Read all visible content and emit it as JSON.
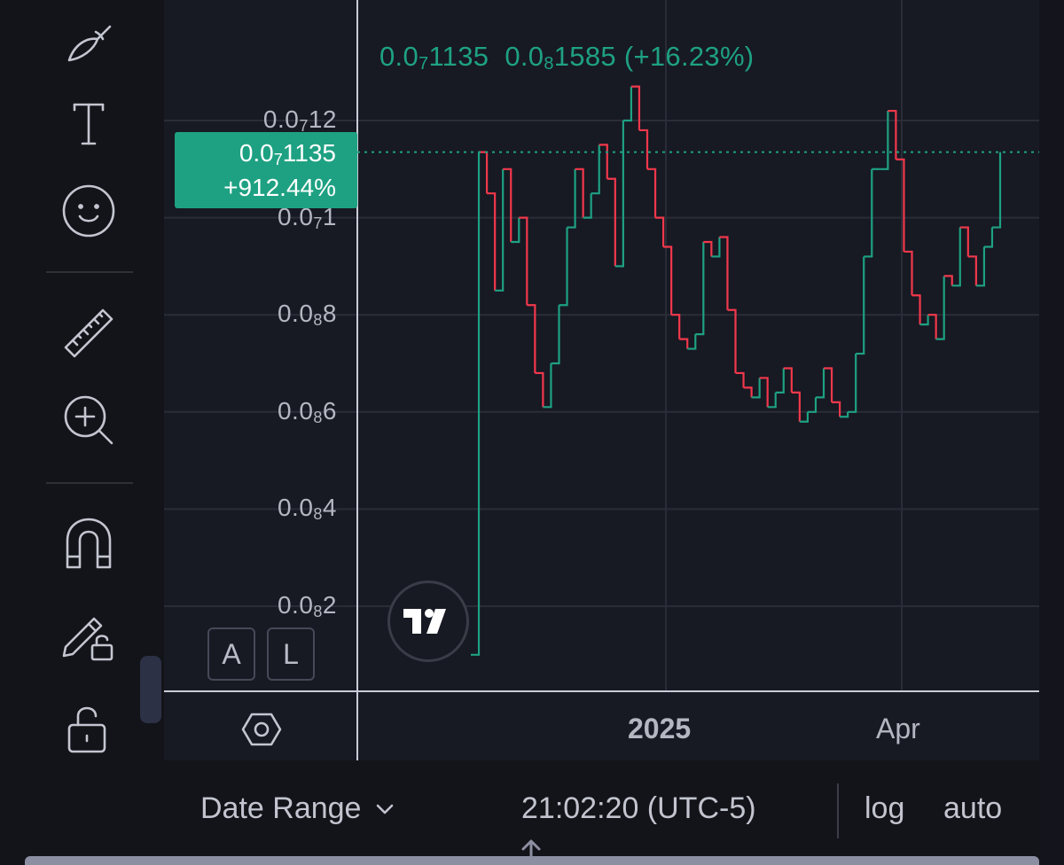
{
  "toolbar": {
    "items": [
      {
        "name": "brush-icon"
      },
      {
        "name": "text-icon"
      },
      {
        "name": "emoji-icon"
      },
      {
        "name": "ruler-icon"
      },
      {
        "name": "zoom-in-icon"
      },
      {
        "name": "magnet-icon"
      },
      {
        "name": "pencil-lock-icon"
      },
      {
        "name": "unlock-icon"
      },
      {
        "name": "eye-icon"
      }
    ]
  },
  "chart": {
    "legend": {
      "close_prefix": "0.0",
      "close_sub": "7",
      "close_rest": "1135",
      "change_prefix": "0.0",
      "change_sub": "8",
      "change_rest": "1585",
      "change_pct": "(+16.23%)"
    },
    "current_price": {
      "prefix": "0.0",
      "sub": "7",
      "rest": "1135",
      "change": "+912.44%"
    },
    "buttons": {
      "auto_scale": "A",
      "log_scale": "L"
    },
    "colors": {
      "up": "#1ea182",
      "down": "#f2384b",
      "grid": "#2a2d37",
      "badge": "#1ea182"
    }
  },
  "chart_data": {
    "type": "line",
    "title": "",
    "xlabel": "",
    "ylabel": "",
    "y_ticks": [
      {
        "prefix": "0.0",
        "sub": "7",
        "rest": "12",
        "value": 1.2e-08
      },
      {
        "prefix": "0.0",
        "sub": "7",
        "rest": "1",
        "value": 1e-08
      },
      {
        "prefix": "0.0",
        "sub": "8",
        "rest": "8",
        "value": 8e-09
      },
      {
        "prefix": "0.0",
        "sub": "8",
        "rest": "6",
        "value": 6e-09
      },
      {
        "prefix": "0.0",
        "sub": "8",
        "rest": "4",
        "value": 4e-09
      },
      {
        "prefix": "0.0",
        "sub": "8",
        "rest": "2",
        "value": 2e-09
      }
    ],
    "x_ticks": [
      "2025",
      "Apr"
    ],
    "ylim": [
      0,
      1.3e-08
    ],
    "last_value": 1.135e-08,
    "series": [
      {
        "values": [
          1e-09,
          1.135e-08,
          1.05e-08,
          8.5e-09,
          1.1e-08,
          9.5e-09,
          1e-08,
          8.2e-09,
          6.8e-09,
          6.1e-09,
          7e-09,
          8.2e-09,
          9.8e-09,
          1.1e-08,
          1e-08,
          1.05e-08,
          1.15e-08,
          1.08e-08,
          9e-09,
          1.2e-08,
          1.27e-08,
          1.18e-08,
          1.1e-08,
          1e-08,
          9.4e-09,
          8e-09,
          7.5e-09,
          7.3e-09,
          7.6e-09,
          9.5e-09,
          9.2e-09,
          9.6e-09,
          8.1e-09,
          6.8e-09,
          6.5e-09,
          6.3e-09,
          6.7e-09,
          6.1e-09,
          6.4e-09,
          6.9e-09,
          6.4e-09,
          5.8e-09,
          6e-09,
          6.3e-09,
          6.9e-09,
          6.2e-09,
          5.9e-09,
          6e-09,
          7.2e-09,
          9.2e-09,
          1.1e-08,
          1.1e-08,
          1.22e-08,
          1.12e-08,
          9.3e-09,
          8.4e-09,
          7.8e-09,
          8e-09,
          7.5e-09,
          8.8e-09,
          8.6e-09,
          9.8e-09,
          9.2e-09,
          8.6e-09,
          9.4e-09,
          9.8e-09,
          1.135e-08
        ]
      }
    ]
  },
  "time_axis": {
    "labels": [
      "2025",
      "Apr"
    ]
  },
  "bottom_bar": {
    "date_range": "Date Range",
    "clock": "21:02:20 (UTC-5)",
    "log": "log",
    "auto": "auto"
  }
}
